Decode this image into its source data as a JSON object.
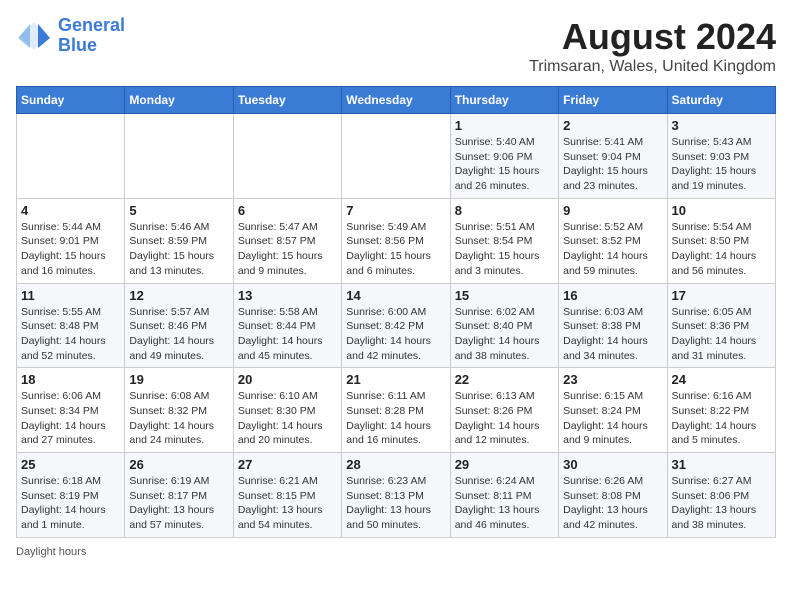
{
  "header": {
    "logo_line1": "General",
    "logo_line2": "Blue",
    "month_title": "August 2024",
    "location": "Trimsaran, Wales, United Kingdom"
  },
  "days_of_week": [
    "Sunday",
    "Monday",
    "Tuesday",
    "Wednesday",
    "Thursday",
    "Friday",
    "Saturday"
  ],
  "weeks": [
    [
      {
        "day": "",
        "info": ""
      },
      {
        "day": "",
        "info": ""
      },
      {
        "day": "",
        "info": ""
      },
      {
        "day": "",
        "info": ""
      },
      {
        "day": "1",
        "info": "Sunrise: 5:40 AM\nSunset: 9:06 PM\nDaylight: 15 hours\nand 26 minutes."
      },
      {
        "day": "2",
        "info": "Sunrise: 5:41 AM\nSunset: 9:04 PM\nDaylight: 15 hours\nand 23 minutes."
      },
      {
        "day": "3",
        "info": "Sunrise: 5:43 AM\nSunset: 9:03 PM\nDaylight: 15 hours\nand 19 minutes."
      }
    ],
    [
      {
        "day": "4",
        "info": "Sunrise: 5:44 AM\nSunset: 9:01 PM\nDaylight: 15 hours\nand 16 minutes."
      },
      {
        "day": "5",
        "info": "Sunrise: 5:46 AM\nSunset: 8:59 PM\nDaylight: 15 hours\nand 13 minutes."
      },
      {
        "day": "6",
        "info": "Sunrise: 5:47 AM\nSunset: 8:57 PM\nDaylight: 15 hours\nand 9 minutes."
      },
      {
        "day": "7",
        "info": "Sunrise: 5:49 AM\nSunset: 8:56 PM\nDaylight: 15 hours\nand 6 minutes."
      },
      {
        "day": "8",
        "info": "Sunrise: 5:51 AM\nSunset: 8:54 PM\nDaylight: 15 hours\nand 3 minutes."
      },
      {
        "day": "9",
        "info": "Sunrise: 5:52 AM\nSunset: 8:52 PM\nDaylight: 14 hours\nand 59 minutes."
      },
      {
        "day": "10",
        "info": "Sunrise: 5:54 AM\nSunset: 8:50 PM\nDaylight: 14 hours\nand 56 minutes."
      }
    ],
    [
      {
        "day": "11",
        "info": "Sunrise: 5:55 AM\nSunset: 8:48 PM\nDaylight: 14 hours\nand 52 minutes."
      },
      {
        "day": "12",
        "info": "Sunrise: 5:57 AM\nSunset: 8:46 PM\nDaylight: 14 hours\nand 49 minutes."
      },
      {
        "day": "13",
        "info": "Sunrise: 5:58 AM\nSunset: 8:44 PM\nDaylight: 14 hours\nand 45 minutes."
      },
      {
        "day": "14",
        "info": "Sunrise: 6:00 AM\nSunset: 8:42 PM\nDaylight: 14 hours\nand 42 minutes."
      },
      {
        "day": "15",
        "info": "Sunrise: 6:02 AM\nSunset: 8:40 PM\nDaylight: 14 hours\nand 38 minutes."
      },
      {
        "day": "16",
        "info": "Sunrise: 6:03 AM\nSunset: 8:38 PM\nDaylight: 14 hours\nand 34 minutes."
      },
      {
        "day": "17",
        "info": "Sunrise: 6:05 AM\nSunset: 8:36 PM\nDaylight: 14 hours\nand 31 minutes."
      }
    ],
    [
      {
        "day": "18",
        "info": "Sunrise: 6:06 AM\nSunset: 8:34 PM\nDaylight: 14 hours\nand 27 minutes."
      },
      {
        "day": "19",
        "info": "Sunrise: 6:08 AM\nSunset: 8:32 PM\nDaylight: 14 hours\nand 24 minutes."
      },
      {
        "day": "20",
        "info": "Sunrise: 6:10 AM\nSunset: 8:30 PM\nDaylight: 14 hours\nand 20 minutes."
      },
      {
        "day": "21",
        "info": "Sunrise: 6:11 AM\nSunset: 8:28 PM\nDaylight: 14 hours\nand 16 minutes."
      },
      {
        "day": "22",
        "info": "Sunrise: 6:13 AM\nSunset: 8:26 PM\nDaylight: 14 hours\nand 12 minutes."
      },
      {
        "day": "23",
        "info": "Sunrise: 6:15 AM\nSunset: 8:24 PM\nDaylight: 14 hours\nand 9 minutes."
      },
      {
        "day": "24",
        "info": "Sunrise: 6:16 AM\nSunset: 8:22 PM\nDaylight: 14 hours\nand 5 minutes."
      }
    ],
    [
      {
        "day": "25",
        "info": "Sunrise: 6:18 AM\nSunset: 8:19 PM\nDaylight: 14 hours\nand 1 minute."
      },
      {
        "day": "26",
        "info": "Sunrise: 6:19 AM\nSunset: 8:17 PM\nDaylight: 13 hours\nand 57 minutes."
      },
      {
        "day": "27",
        "info": "Sunrise: 6:21 AM\nSunset: 8:15 PM\nDaylight: 13 hours\nand 54 minutes."
      },
      {
        "day": "28",
        "info": "Sunrise: 6:23 AM\nSunset: 8:13 PM\nDaylight: 13 hours\nand 50 minutes."
      },
      {
        "day": "29",
        "info": "Sunrise: 6:24 AM\nSunset: 8:11 PM\nDaylight: 13 hours\nand 46 minutes."
      },
      {
        "day": "30",
        "info": "Sunrise: 6:26 AM\nSunset: 8:08 PM\nDaylight: 13 hours\nand 42 minutes."
      },
      {
        "day": "31",
        "info": "Sunrise: 6:27 AM\nSunset: 8:06 PM\nDaylight: 13 hours\nand 38 minutes."
      }
    ]
  ],
  "footer": {
    "daylight_label": "Daylight hours"
  }
}
